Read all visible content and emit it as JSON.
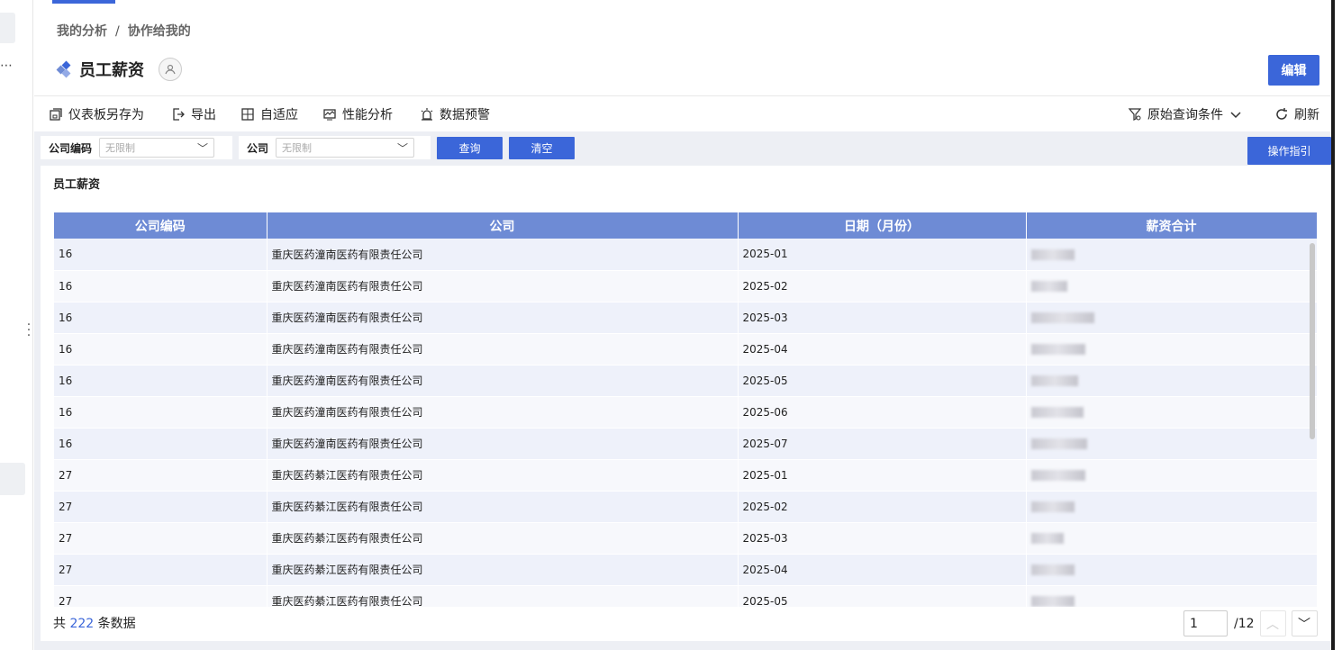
{
  "breadcrumb": {
    "parent": "我的分析",
    "separator": "/",
    "current": "协作给我的"
  },
  "title": "员工薪资",
  "edit_label": "编辑",
  "toolbar": {
    "save_as": "仪表板另存为",
    "export": "导出",
    "adaptive": "自适应",
    "performance": "性能分析",
    "alert": "数据预警",
    "query_conditions": "原始查询条件",
    "refresh": "刷新"
  },
  "filters": [
    {
      "label": "公司编码",
      "placeholder": "无限制"
    },
    {
      "label": "公司",
      "placeholder": "无限制"
    }
  ],
  "query_label": "查询",
  "clear_label": "清空",
  "guide_label": "操作指引",
  "card_title": "员工薪资",
  "table": {
    "headers": [
      "公司编码",
      "公司",
      "日期（月份）",
      "薪资合计"
    ],
    "rows": [
      [
        "16",
        "重庆医药潼南医药有限责任公司",
        "2025-01"
      ],
      [
        "16",
        "重庆医药潼南医药有限责任公司",
        "2025-02"
      ],
      [
        "16",
        "重庆医药潼南医药有限责任公司",
        "2025-03"
      ],
      [
        "16",
        "重庆医药潼南医药有限责任公司",
        "2025-04"
      ],
      [
        "16",
        "重庆医药潼南医药有限责任公司",
        "2025-05"
      ],
      [
        "16",
        "重庆医药潼南医药有限责任公司",
        "2025-06"
      ],
      [
        "16",
        "重庆医药潼南医药有限责任公司",
        "2025-07"
      ],
      [
        "27",
        "重庆医药綦江医药有限责任公司",
        "2025-01"
      ],
      [
        "27",
        "重庆医药綦江医药有限责任公司",
        "2025-02"
      ],
      [
        "27",
        "重庆医药綦江医药有限责任公司",
        "2025-03"
      ],
      [
        "27",
        "重庆医药綦江医药有限责任公司",
        "2025-04"
      ],
      [
        "27",
        "重庆医药綦江医药有限责任公司",
        "2025-05"
      ]
    ]
  },
  "footer": {
    "prefix": "共",
    "count": "222",
    "suffix": "条数据"
  },
  "pager": {
    "page": "1",
    "total": "/12"
  },
  "colors": {
    "accent": "#3b66d9",
    "header": "#6e8bd5"
  },
  "icons": [
    "save-as-icon",
    "export-icon",
    "adaptive-icon",
    "performance-icon",
    "alert-icon",
    "filter-icon",
    "refresh-icon",
    "share-icon",
    "diamond-icon"
  ]
}
